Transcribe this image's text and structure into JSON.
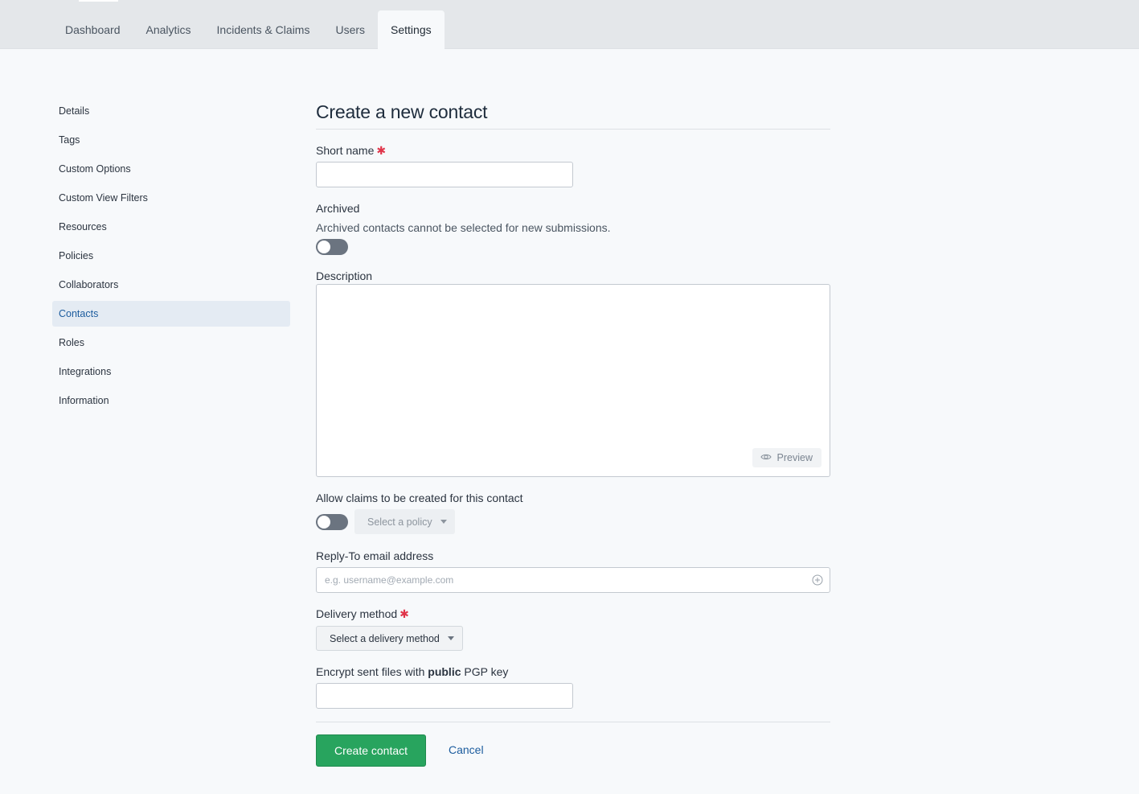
{
  "nav": {
    "tabs": [
      "Dashboard",
      "Analytics",
      "Incidents & Claims",
      "Users",
      "Settings"
    ],
    "active_tab": "Settings"
  },
  "sidebar": {
    "items": [
      "Details",
      "Tags",
      "Custom Options",
      "Custom View Filters",
      "Resources",
      "Policies",
      "Collaborators",
      "Contacts",
      "Roles",
      "Integrations",
      "Information"
    ],
    "active_item": "Contacts"
  },
  "form": {
    "title": "Create a new contact",
    "short_name": {
      "label": "Short name",
      "required_marker": "✱",
      "value": ""
    },
    "archived": {
      "label": "Archived",
      "help": "Archived contacts cannot be selected for new submissions.",
      "enabled": false
    },
    "description": {
      "label": "Description",
      "value": "",
      "preview_label": "Preview"
    },
    "allow_claims": {
      "label": "Allow claims to be created for this contact",
      "enabled": false,
      "policy_select": "Select a policy"
    },
    "reply_to": {
      "label": "Reply-To email address",
      "placeholder": "e.g. username@example.com",
      "value": ""
    },
    "delivery": {
      "label": "Delivery method",
      "required_marker": "✱",
      "select": "Select a delivery method"
    },
    "pgp": {
      "label_pre": "Encrypt sent files with ",
      "label_bold": "public",
      "label_post": " PGP key",
      "value": ""
    },
    "actions": {
      "submit": "Create contact",
      "cancel": "Cancel"
    }
  },
  "colors": {
    "primary_button": "#28a45e",
    "link": "#1c5c9e",
    "required": "#e0354a",
    "active_nav_bg": "#e4ebf3"
  },
  "icons": {
    "preview": "eye-icon",
    "email_add": "plus-circle-icon",
    "dropdown": "caret-down-icon"
  }
}
